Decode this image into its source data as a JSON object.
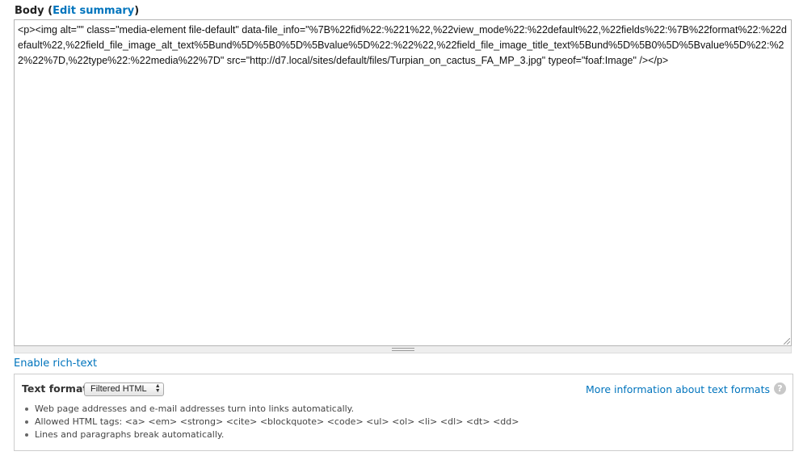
{
  "field": {
    "label": "Body",
    "edit_summary_open": "(",
    "edit_summary_link": "Edit summary",
    "edit_summary_close": ")"
  },
  "editor": {
    "value": "<p><img alt=\"\" class=\"media-element file-default\" data-file_info=\"%7B%22fid%22:%221%22,%22view_mode%22:%22default%22,%22fields%22:%7B%22format%22:%22default%22,%22field_file_image_alt_text%5Bund%5D%5B0%5D%5Bvalue%5D%22:%22%22,%22field_file_image_title_text%5Bund%5D%5B0%5D%5Bvalue%5D%22:%22%22%7D,%22type%22:%22media%22%7D\" src=\"http://d7.local/sites/default/files/Turpian_on_cactus_FA_MP_3.jpg\" typeof=\"foaf:Image\" /></p>"
  },
  "rich_text_toggle": "Enable rich-text",
  "text_format": {
    "label": "Text format",
    "selected": "Filtered HTML",
    "more_info_link": "More information about text formats",
    "help_icon": "question-icon",
    "tips": [
      "Web page addresses and e-mail addresses turn into links automatically.",
      "Allowed HTML tags: <a> <em> <strong> <cite> <blockquote> <code> <ul> <ol> <li> <dl> <dt> <dd>",
      "Lines and paragraphs break automatically."
    ]
  },
  "colors": {
    "link": "#0074bd",
    "border": "#b4b4b4"
  }
}
